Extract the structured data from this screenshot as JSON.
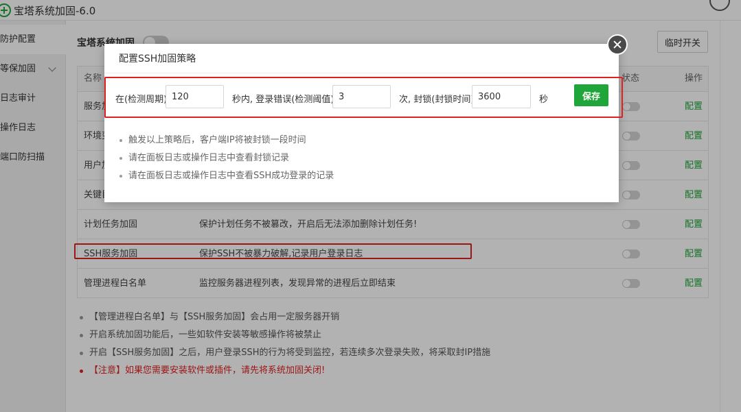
{
  "window": {
    "title": "宝塔系统加固-6.0",
    "icon": "shield-plus-icon"
  },
  "sidebar": {
    "items": [
      {
        "label": "防护配置"
      },
      {
        "label": "等保加固"
      },
      {
        "label": "日志审计"
      },
      {
        "label": "操作日志"
      },
      {
        "label": "端口防扫描"
      }
    ]
  },
  "main": {
    "master_label": "宝塔系统加固",
    "temp_switch_label": "临时开关",
    "table": {
      "headers": {
        "name": "名称",
        "status": "状态",
        "action": "操作"
      },
      "rows": [
        {
          "name": "服务加",
          "desc": "",
          "action": "配置"
        },
        {
          "name": "环境变",
          "desc": "",
          "action": "配置"
        },
        {
          "name": "用户加",
          "desc": "",
          "action": "配置"
        },
        {
          "name": "关键目",
          "desc": "",
          "action": "配置"
        },
        {
          "name": "计划任务加固",
          "desc": "保护计划任务不被篡改，开启后无法添加删除计划任务!",
          "action": "配置"
        },
        {
          "name": "SSH服务加固",
          "desc": "保护SSH不被暴力破解,记录用户登录日志",
          "action": "配置"
        },
        {
          "name": "管理进程白名单",
          "desc": "监控服务器进程列表，发现异常的进程后立即结束",
          "action": "配置"
        }
      ]
    },
    "notes": [
      "【管理进程白名单】与【SSH服务加固】会占用一定服务器开销",
      "开启系统加固功能后，一些如软件安装等敏感操作将被禁止",
      "开启【SSH服务加固】之后，用户登录SSH的行为将受到监控，若连续多次登录失败，将采取封IP措施"
    ],
    "warning": "【注意】如果您需要安装软件或插件，请先将系统加固关闭!"
  },
  "modal": {
    "title": "配置SSH加固策略",
    "form": {
      "prefix_label": "在(检测周期)",
      "cycle_value": "120",
      "mid_label": "秒内, 登录错误(检测阈值)",
      "threshold_value": "3",
      "lock_label": "次, 封锁(封锁时间)",
      "lock_value": "3600",
      "unit_label": "秒",
      "save_label": "保存"
    },
    "notes": [
      "触发以上策略后，客户端IP将被封锁一段时间",
      "请在面板日志或操作日志中查看封锁记录",
      "请在面板日志或操作日志中查看SSH成功登录的记录"
    ]
  },
  "colors": {
    "accent": "#20a53a",
    "highlight": "#e02020",
    "warning": "#e02020"
  }
}
